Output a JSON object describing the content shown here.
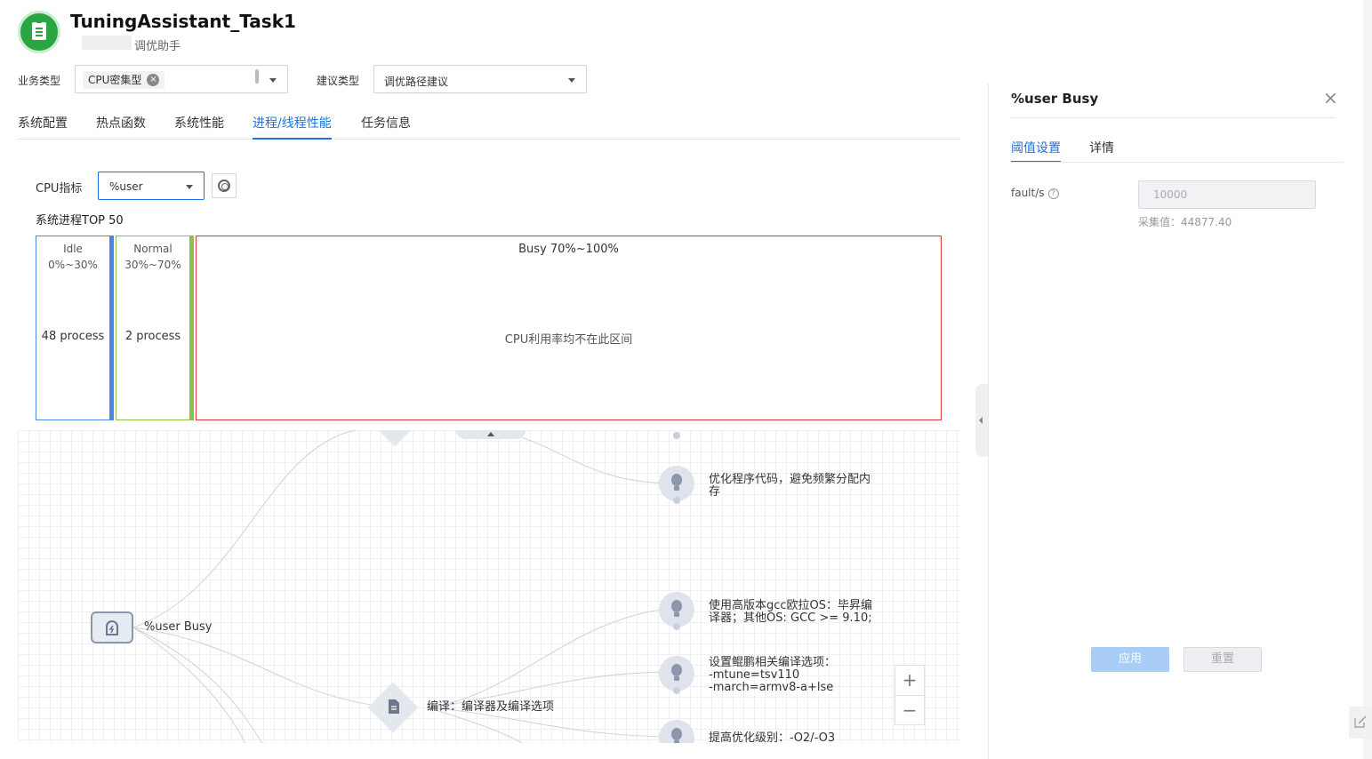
{
  "header": {
    "title": "TuningAssistant_Task1",
    "subtitle": "调优助手"
  },
  "filters": {
    "business_type_label": "业务类型",
    "business_type_tag": "CPU密集型",
    "suggestion_type_label": "建议类型",
    "suggestion_type_value": "调优路径建议"
  },
  "tabs": [
    {
      "label": "系统配置"
    },
    {
      "label": "热点函数"
    },
    {
      "label": "系统性能"
    },
    {
      "label": "进程/线程性能"
    },
    {
      "label": "任务信息"
    }
  ],
  "cpu": {
    "label": "CPU指标",
    "value": "%user"
  },
  "top_section": {
    "title": "系统进程TOP 50"
  },
  "buckets": {
    "idle": {
      "name": "Idle",
      "range": "0%~30%",
      "count": "48 process"
    },
    "normal": {
      "name": "Normal",
      "range": "30%~70%",
      "count": "2 process"
    },
    "busy": {
      "name": "Busy 70%~100%",
      "empty": "CPU利用率均不在此区间"
    }
  },
  "graph": {
    "root": "%user Busy",
    "compile": "编译：编译器及编译选项",
    "s1": [
      "优化程序代码，避免频繁分配内",
      "存"
    ],
    "s2": [
      "使用高版本gcc欧拉OS：毕昇编",
      "译器；其他OS: GCC >= 9.10;"
    ],
    "s3": [
      "设置鲲鹏相关编译选项：",
      "-mtune=tsv110",
      "-march=armv8-a+lse"
    ],
    "s4": [
      "提高优化级别：-O2/-O3"
    ],
    "zoom_in": "+",
    "zoom_out": "−"
  },
  "panel": {
    "title": "%user Busy",
    "tabs": [
      {
        "label": "阈值设置"
      },
      {
        "label": "详情"
      }
    ],
    "field_label": "fault/s",
    "field_placeholder": "10000",
    "collected": "采集值：44877.40",
    "apply": "应用",
    "reset": "重置"
  },
  "colors": {
    "accent": "#1a73e8",
    "idle": "#4a86e8",
    "normal": "#8bc34a",
    "busy": "#e53935"
  }
}
